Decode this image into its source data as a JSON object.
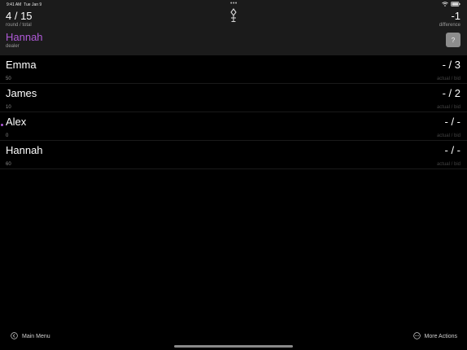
{
  "status_bar": {
    "time": "9:41 AM",
    "date": "Tue Jan 9",
    "dots": "•••"
  },
  "header": {
    "round": "4 / 15",
    "round_label": "round / total",
    "dealer": "Hannah",
    "dealer_label": "dealer",
    "difference": "-1",
    "difference_label": "difference",
    "help_label": "?",
    "center_icon": "microphone-stand-icon"
  },
  "players": [
    {
      "name": "Emma",
      "score": "50",
      "bid": "- / 3",
      "bid_label": "actual / bid",
      "active": false
    },
    {
      "name": "James",
      "score": "10",
      "bid": "- / 2",
      "bid_label": "actual / bid",
      "active": false
    },
    {
      "name": "Alex",
      "score": "0",
      "bid": "- / -",
      "bid_label": "actual / bid",
      "active": true
    },
    {
      "name": "Hannah",
      "score": "60",
      "bid": "- / -",
      "bid_label": "actual / bid",
      "active": false
    }
  ],
  "toolbar": {
    "main_menu_label": "Main Menu",
    "main_menu_icon": "chevron-left-circle-icon",
    "more_actions_label": "More Actions",
    "more_actions_icon": "ellipsis-circle-icon"
  },
  "colors": {
    "accent": "#b05ad8",
    "header_bg": "#1b1b1b",
    "background": "#000000"
  }
}
